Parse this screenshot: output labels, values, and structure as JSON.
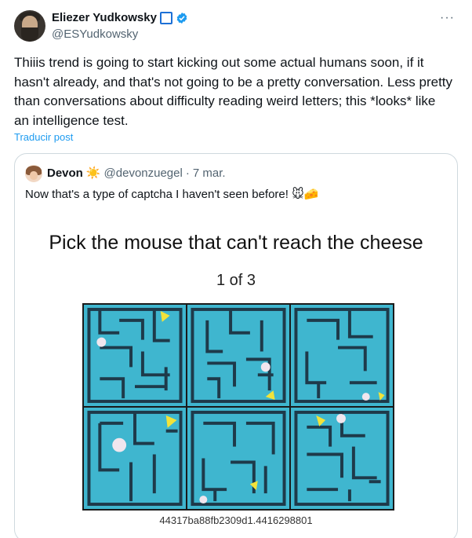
{
  "author": {
    "display_name": "Eliezer Yudkowsky",
    "handle": "@ESYudkowsky"
  },
  "tweet": {
    "text": "Thiiis trend is going to start kicking out some actual humans soon, if it hasn't already, and that's not going to be a pretty conversation.  Less pretty than conversations about difficulty reading weird letters; this *looks* like an intelligence test.",
    "translate_label": "Traducir post",
    "more_label": "···"
  },
  "quoted": {
    "display_name": "Devon",
    "name_emoji": "☀️",
    "handle": "@devonzuegel",
    "separator": "·",
    "date": "7 mar.",
    "text": "Now that's a type of captcha I haven't seen before! 🐭🧀"
  },
  "captcha": {
    "title": "Pick the mouse that can't reach the cheese",
    "counter": "1 of 3",
    "id": "44317ba88fb2309d1.4416298801"
  },
  "colors": {
    "accent": "#1d9bf0",
    "verified": "#1d9bf0",
    "maze_bg": "#3fb6cf",
    "maze_wall": "#1e3a4a"
  }
}
